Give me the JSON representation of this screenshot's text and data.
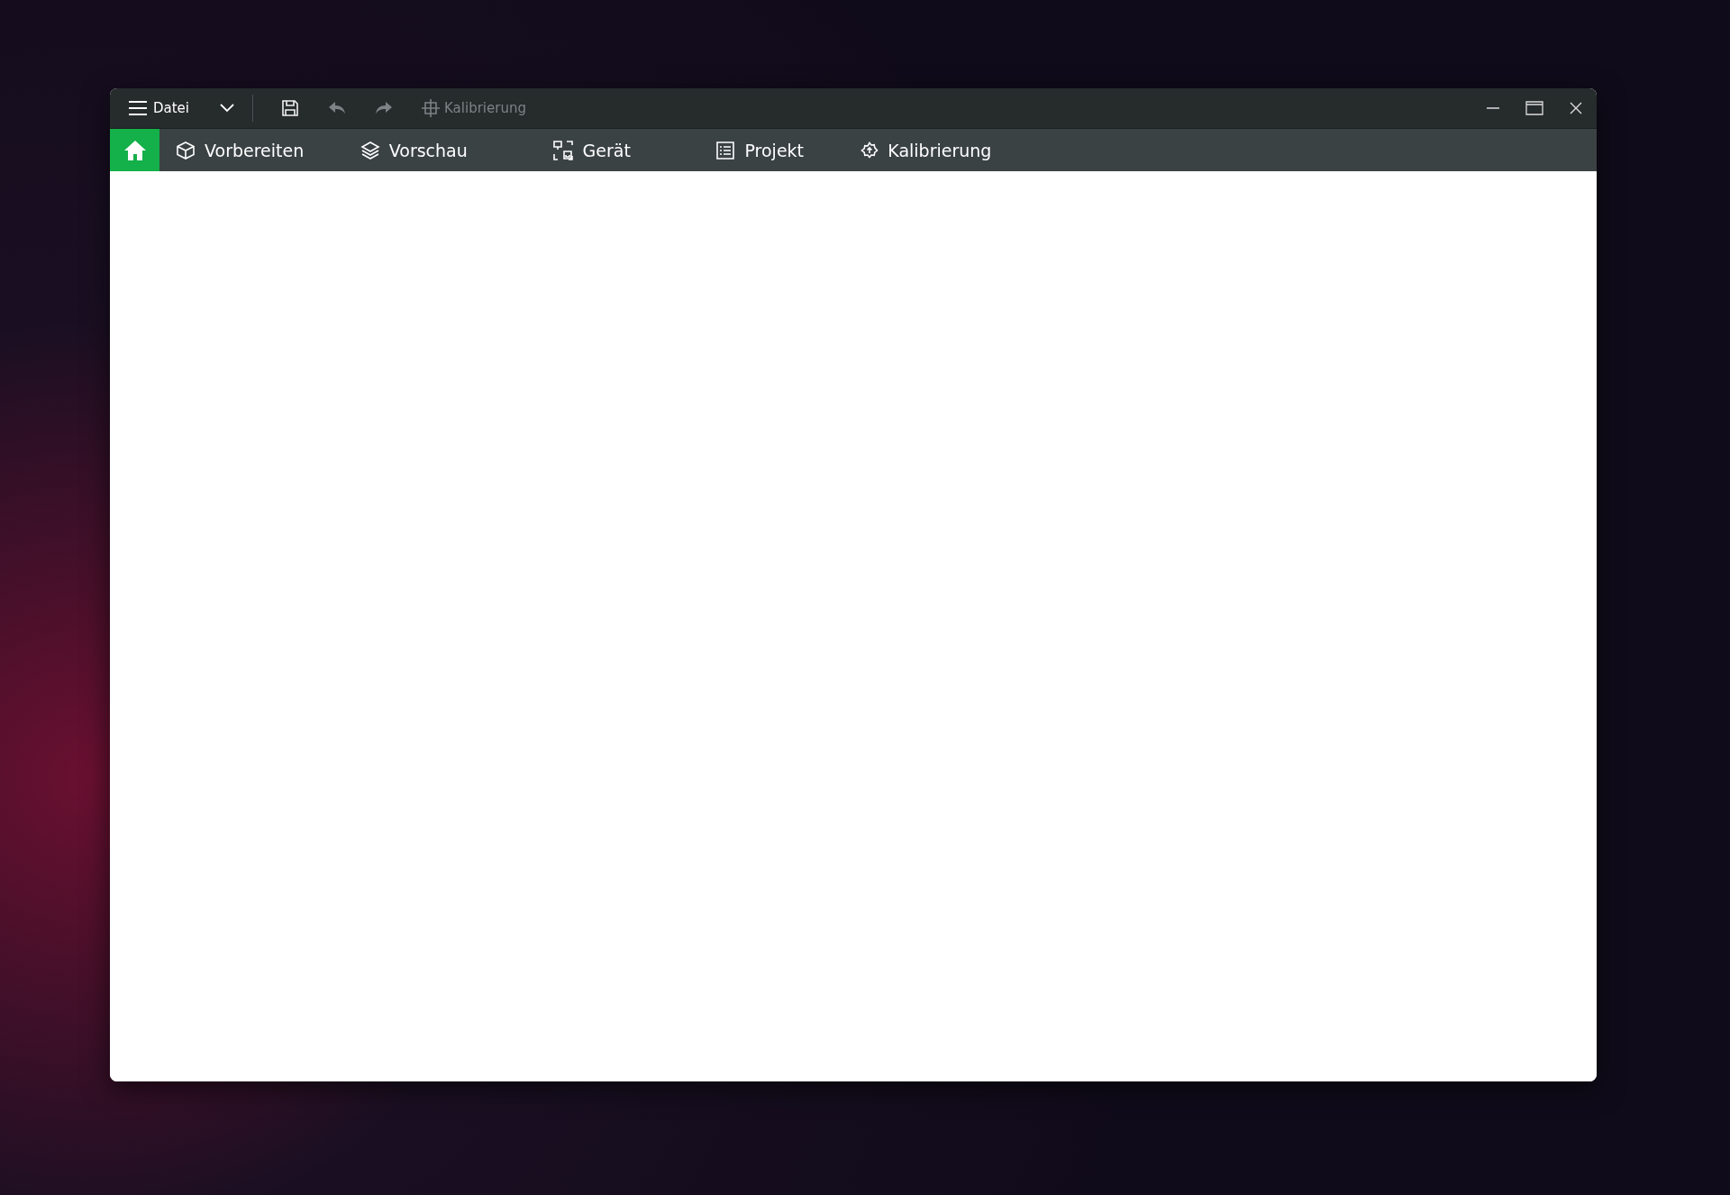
{
  "title_bar": {
    "menu_label": "Datei",
    "tools": [
      {
        "kind": "save",
        "disabled": false
      },
      {
        "kind": "undo",
        "disabled": true
      },
      {
        "kind": "redo",
        "disabled": true
      },
      {
        "kind": "calibrate",
        "label": "Kalibrierung",
        "disabled": true
      }
    ]
  },
  "tabs": [
    {
      "kind": "home",
      "selected": true
    },
    {
      "kind": "prepare",
      "label": "Vorbereiten",
      "selected": false
    },
    {
      "kind": "preview",
      "label": "Vorschau",
      "selected": false
    },
    {
      "kind": "device",
      "label": "Gerät",
      "selected": false
    },
    {
      "kind": "project",
      "label": "Projekt",
      "selected": false
    },
    {
      "kind": "calibration",
      "label": "Kalibrierung",
      "selected": false
    }
  ]
}
